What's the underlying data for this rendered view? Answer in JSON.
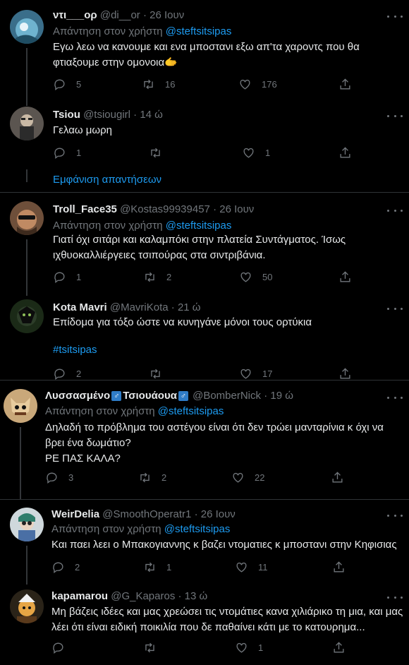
{
  "tweets": [
    {
      "display_name": "ντι___ορ",
      "handle": "@di__or",
      "time": "· 26 Ιουν",
      "reply_prefix": "Απάντηση στον χρήστη",
      "reply_to": "@steftsitsipas",
      "text": "Εγω λεω να κανουμε και ενα μποστανι εξω απ'τα χαροντς που θα φτιαξουμε στην ομονοια🫱",
      "replies": "5",
      "retweets": "16",
      "likes": "176"
    },
    {
      "display_name": "Tsiou",
      "handle": "@tsiougirl",
      "time": "· 14 ώ",
      "text": "Γελαω μωρη",
      "replies": "1",
      "retweets": "",
      "likes": "1"
    },
    {
      "display_name": "Troll_Face35",
      "handle": "@Kostas99939457",
      "time": "· 26 Ιουν",
      "reply_prefix": "Απάντηση στον χρήστη",
      "reply_to": "@steftsitsipas",
      "text": "Γιατί όχι σιτάρι και καλαμπόκι στην πλατεία Συντάγματος. Ίσως ιχθυοκαλλιέργειες τσιπούρας  στα σιντριβάνια.",
      "replies": "1",
      "retweets": "2",
      "likes": "50"
    },
    {
      "display_name": "Kota Mavri",
      "handle": "@MavriKota",
      "time": "· 21 ώ",
      "text": "Επίδομα για τόξο ώστε να κυνηγάνε μόνοι τους ορτύκια",
      "hashtag": "#tsitsipas",
      "replies": "2",
      "retweets": "",
      "likes": "17"
    },
    {
      "display_name_part1": "Λυσσασμένο",
      "display_name_part2": "Τσιουάουα",
      "gender_symbol": "♂",
      "handle": "@BomberNick",
      "time": "· 19 ώ",
      "reply_prefix": "Απάντηση στον χρήστη",
      "reply_to": "@steftsitsipas",
      "text": "Δηλαδή το πρόβλημα του αστέγου είναι ότι δεν τρώει μανταρίνια κ όχι να βρει ένα δωμάτιο?\nΡΕ ΠΑΣ ΚΑΛΑ?",
      "replies": "3",
      "retweets": "2",
      "likes": "22"
    },
    {
      "display_name": "WeirDelia",
      "handle": "@SmoothOperatr1",
      "time": "· 26 Ιουν",
      "reply_prefix": "Απάντηση στον χρήστη",
      "reply_to": "@steftsitsipas",
      "text": "Και παει λεει ο Μπακογιαννης κ βαζει ντοματιες κ μποστανι στην Κηφισιας",
      "replies": "2",
      "retweets": "1",
      "likes": "11"
    },
    {
      "display_name": "kapamarou",
      "handle": "@G_Kaparos",
      "time": "· 13 ώ",
      "text": "Μη βάζεις ιδέες και μας χρεώσει τις ντομάτιες κανα χιλιάρικο τη μια, και μας λέει ότι είναι ειδική ποικιλία που δε παθαίνει κάτι με το κατουρημα...",
      "replies": "",
      "retweets": "",
      "likes": "1"
    }
  ],
  "show_replies": "Εμφάνιση απαντήσεων",
  "icons": [
    "reply-icon",
    "retweet-icon",
    "like-icon",
    "share-icon",
    "more-icon"
  ],
  "colors": {
    "background": "#000000",
    "accent": "#1d9bf0",
    "muted": "#71767b",
    "divider": "#2f3336"
  }
}
